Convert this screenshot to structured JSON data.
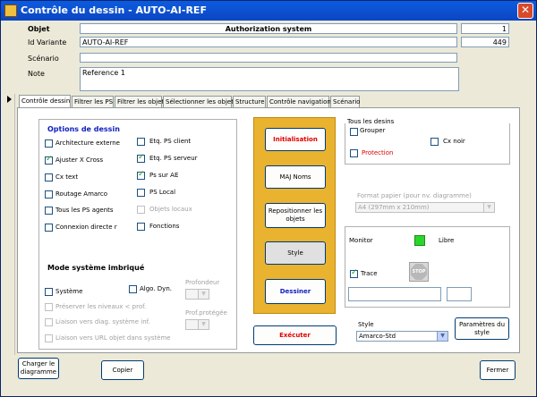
{
  "window": {
    "title": "Contrôle du dessin - AUTO-AI-REF",
    "close_symbol": "✕"
  },
  "header": {
    "objet_label": "Objet",
    "objet_value": "Authorization system",
    "objet_count": "1",
    "id_variante_label": "Id Variante",
    "id_variante_value": "AUTO-AI-REF",
    "id_variante_count": "449",
    "scenario_label": "Scénario",
    "scenario_value": "",
    "note_label": "Note",
    "note_value": "Reference 1"
  },
  "tabs": [
    {
      "label": "Contrôle dessin"
    },
    {
      "label": "Filtrer les PS"
    },
    {
      "label": "Filtrer les objets"
    },
    {
      "label": "Sélectionner les objets"
    },
    {
      "label": "Structure"
    },
    {
      "label": "Contrôle navigation"
    },
    {
      "label": "Scénario"
    }
  ],
  "options": {
    "title": "Options de dessin",
    "left": [
      {
        "label": "Architecture externe",
        "checked": false
      },
      {
        "label": "Ajuster X Cross",
        "checked": true
      },
      {
        "label": "Cx text",
        "checked": false
      },
      {
        "label": "Routage Amarco",
        "checked": false
      },
      {
        "label": "Tous les PS agents",
        "checked": false
      },
      {
        "label": "Connexion directe r",
        "checked": false
      }
    ],
    "right": [
      {
        "label": "Etq. PS client",
        "checked": false
      },
      {
        "label": "Etq. PS serveur",
        "checked": true
      },
      {
        "label": "Ps sur AE",
        "checked": true
      },
      {
        "label": "PS Local",
        "checked": false
      },
      {
        "label": "Objets locaux",
        "checked": false,
        "disabled": true
      },
      {
        "label": "Fonctions",
        "checked": false
      }
    ]
  },
  "mode": {
    "title": "Mode système imbriqué",
    "systeme": "Système",
    "algo": "Algo. Dyn.",
    "profondeur": "Profondeur",
    "prof_protegee": "Prof.protégée",
    "preserver": "Préserver les niveaux < prof.",
    "liaison_diag": "Liaison  vers diag. système inf.",
    "liaison_url": "Liaison vers URL objet dans système"
  },
  "actions": {
    "initialisation": "Initialisation",
    "maj_noms": "MAJ Noms",
    "repositionner": "Repositionner les objets",
    "style": "Style",
    "dessiner": "Dessiner",
    "executer": "Exécuter"
  },
  "designs": {
    "title": "Tous les desins",
    "grouper": "Grouper",
    "cx_noir": "Cx noir",
    "protection": "Protection",
    "format_label": "Format papier (pour nv. diagramme)",
    "format_value": "A4 (297mm x 210mm)"
  },
  "monitor": {
    "label": "Monitor",
    "status": "Libre",
    "status_color": "#2bd62b",
    "trace": "Trace",
    "trace_checked": true,
    "stop": "STOP"
  },
  "style_select": {
    "label": "Style",
    "value": "Amarco-Std",
    "params_button": "Paramètres du style"
  },
  "footer": {
    "charger": "Charger le diagramme",
    "copier": "Copier",
    "fermer": "Fermer"
  }
}
